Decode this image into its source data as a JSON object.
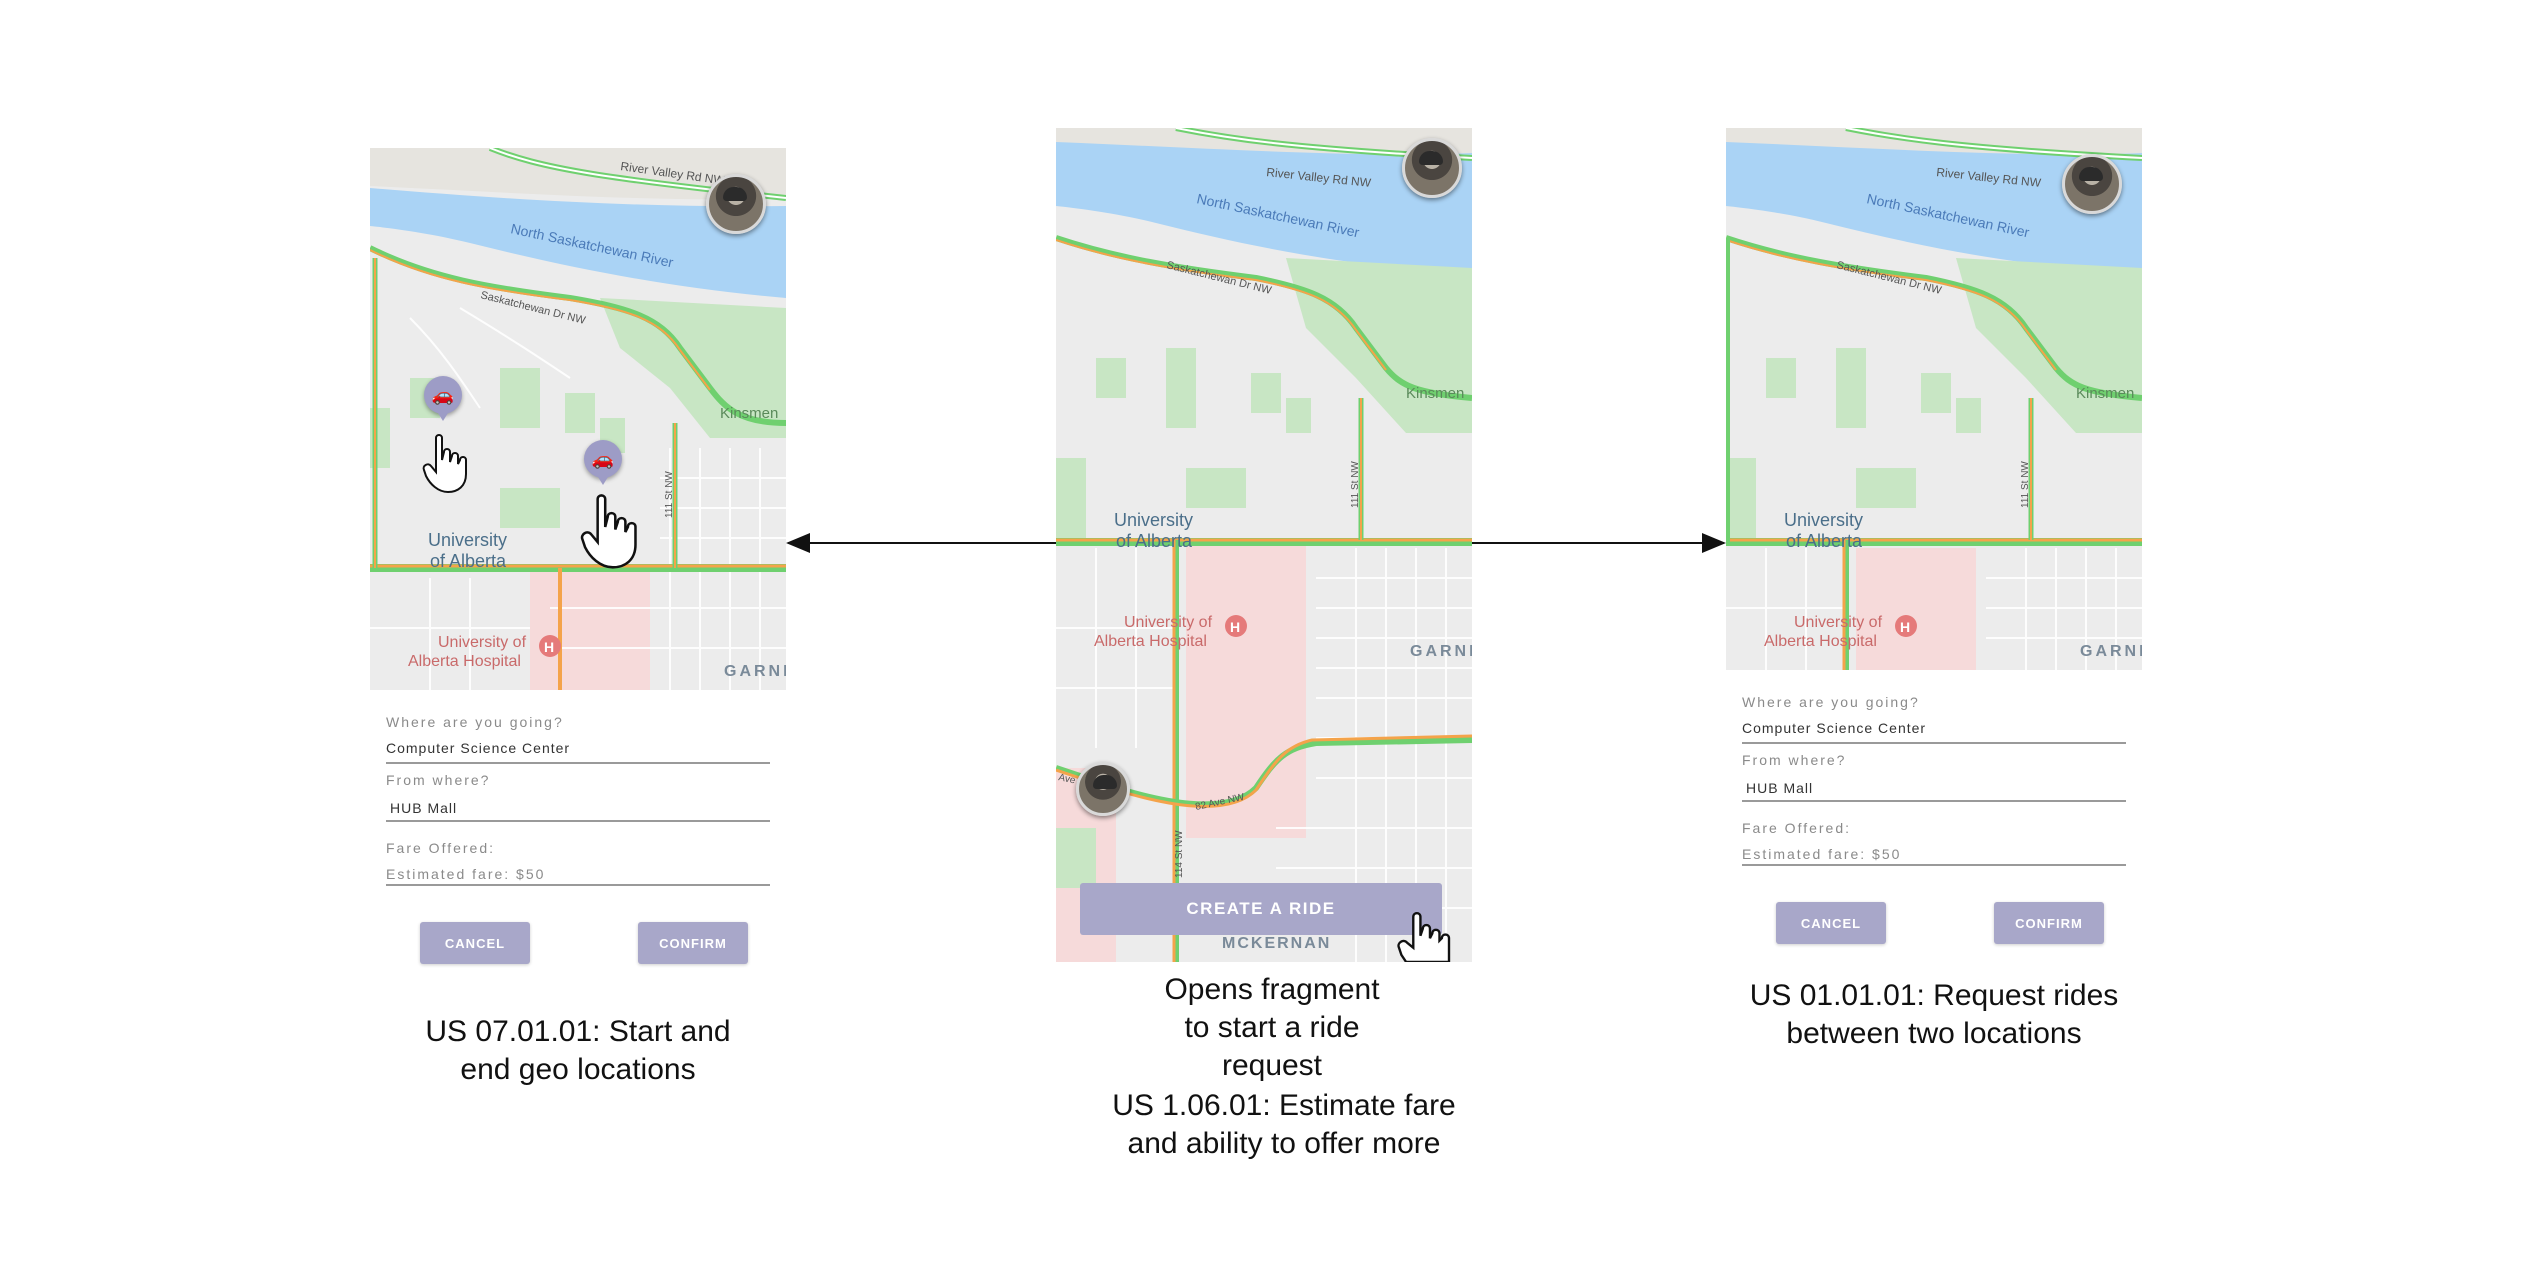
{
  "map": {
    "river_road": "River Valley Rd NW",
    "river_name": "North Saskatchewan River",
    "drive_name": "Saskatchewan Dr NW",
    "park_name": "Kinsmen",
    "university_line1": "University",
    "university_line2": "of Alberta",
    "hospital_line1": "University of",
    "hospital_line2": "Alberta Hospital",
    "neighbourhood": "GARNE",
    "street_111": "111 St NW",
    "street_114": "114 St NW",
    "avenue_82": "82 Ave NW",
    "ave_short": "Ave",
    "mckernan": "MCKERNAN",
    "hospital_icon": "H"
  },
  "left_screen": {
    "where_label": "Where are you going?",
    "where_value": "Computer Science Center",
    "from_label": "From where?",
    "from_value": "HUB Mall",
    "fare_label": "Fare Offered:",
    "fare_value": "Estimated fare: $50",
    "cancel_label": "CANCEL",
    "confirm_label": "CONFIRM"
  },
  "center_screen": {
    "create_label": "CREATE A RIDE"
  },
  "right_screen": {
    "where_label": "Where are you going?",
    "where_value": "Computer Science Center",
    "from_label": "From where?",
    "from_value": "HUB Mall",
    "fare_label": "Fare Offered:",
    "fare_value": "Estimated fare: $50",
    "cancel_label": "CANCEL",
    "confirm_label": "CONFIRM"
  },
  "captions": {
    "left_line1": "US 07.01.01: Start and",
    "left_line2": "end geo locations",
    "center_line1": "Opens fragment",
    "center_line2": "to start a ride",
    "center_line3": "request",
    "center_line4": "US 1.06.01: Estimate fare",
    "center_line5": "and ability to offer more",
    "right_line1": "US 01.01.01: Request rides",
    "right_line2": "between two locations"
  },
  "icons": {
    "avatar": "profile-photo",
    "pin": "car-pin-icon",
    "hand": "hand-cursor-icon"
  },
  "colors": {
    "river": "#aad3f5",
    "park": "#c8e6c4",
    "hospital_area": "#f6dada",
    "road_orange": "#f4a34a",
    "road_green": "#6fd06f",
    "button": "#a8a7c9"
  }
}
